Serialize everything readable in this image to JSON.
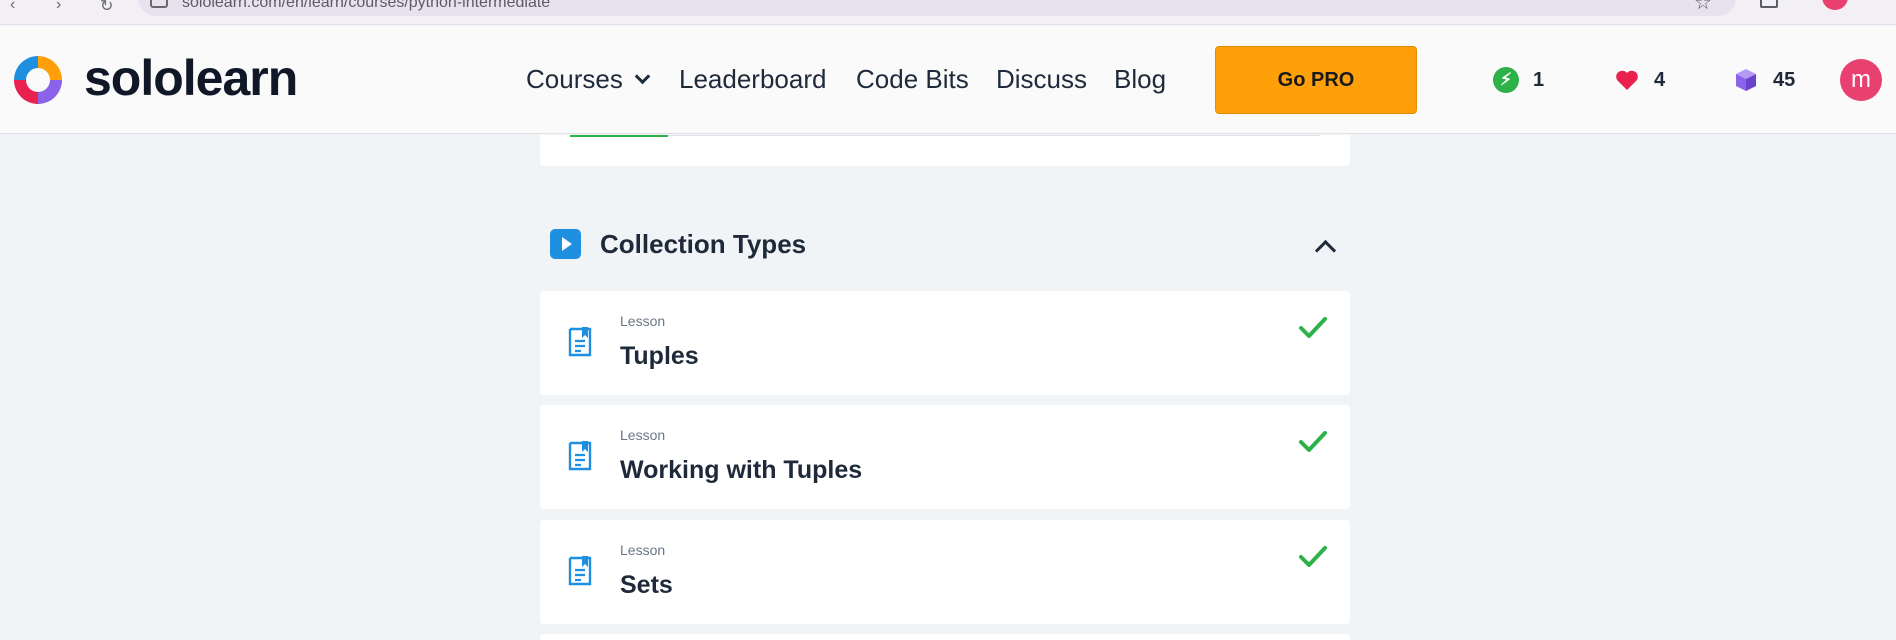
{
  "browser": {
    "url": "sololearn.com/en/learn/courses/python-intermediate"
  },
  "header": {
    "logo_text": "sololearn",
    "nav": {
      "courses": "Courses",
      "leaderboard": "Leaderboard",
      "code_bits": "Code Bits",
      "discuss": "Discuss",
      "blog": "Blog"
    },
    "go_pro": "Go PRO",
    "stats": {
      "streak": "1",
      "hearts": "4",
      "gems": "45"
    },
    "avatar_letter": "m"
  },
  "module": {
    "title": "Collection Types",
    "icon": "play-icon",
    "expanded": true
  },
  "lessons": [
    {
      "kind": "Lesson",
      "title": "Tuples",
      "completed": true
    },
    {
      "kind": "Lesson",
      "title": "Working with Tuples",
      "completed": true
    },
    {
      "kind": "Lesson",
      "title": "Sets",
      "completed": true
    }
  ],
  "colors": {
    "brand_orange": "#ff9f0a",
    "success_green": "#2db24a",
    "accent_blue": "#1f8fe0",
    "heart_red": "#e8214f",
    "gem_purple": "#8b63e8",
    "avatar_pink": "#e8416f"
  }
}
